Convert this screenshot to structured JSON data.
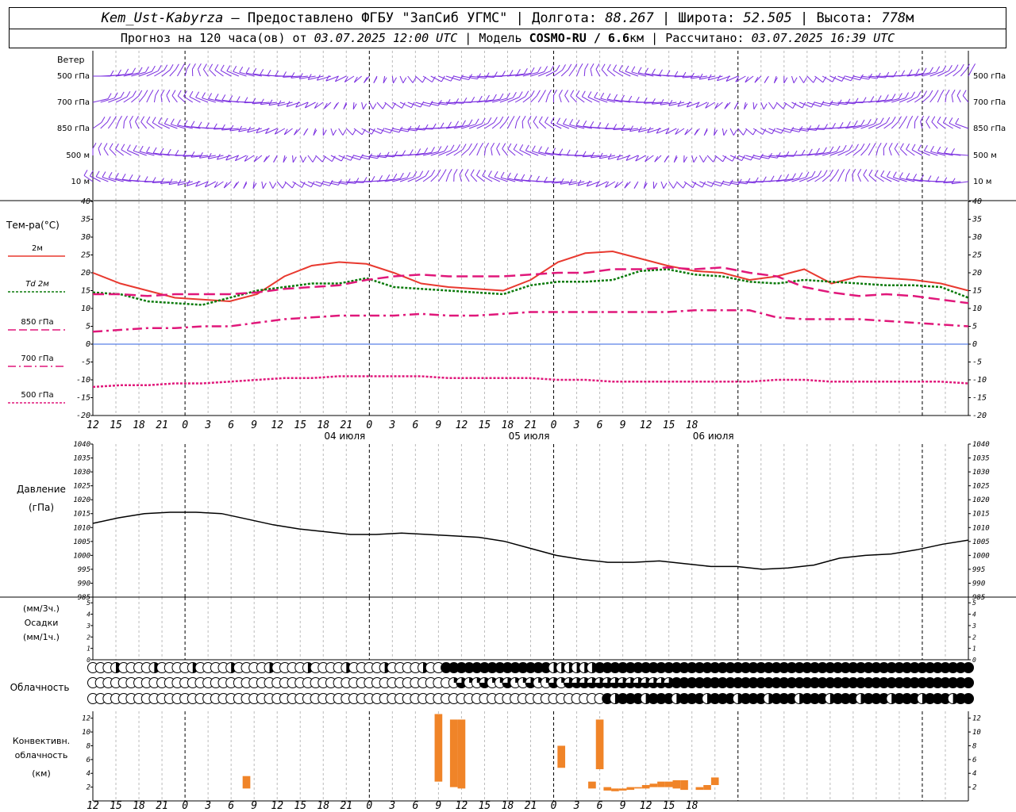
{
  "header": {
    "station": "Kem_Ust-Kabyrza",
    "sep": " — ",
    "provider": "Предоставлено ФГБУ \"ЗапСиб УГМС\"",
    "lon_label": "Долгота:",
    "lon": "88.267",
    "lat_label": "Широта:",
    "lat": "52.505",
    "alt_label": "Высота:",
    "alt": "778",
    "alt_unit": "м",
    "forecast_label": "Прогноз на 120 часа(ов) от",
    "forecast_time": "03.07.2025 12:00 UTC",
    "model_label": "Модель",
    "model": "COSMO-RU / 6.6",
    "model_unit": "км",
    "calc_label": "Рассчитано:",
    "calc_time": "03.07.2025 16:39 UTC"
  },
  "wind_panel": {
    "title": "Ветер",
    "levels": [
      "500 гПа",
      "700 гПа",
      "850 гПа",
      "500 м",
      "10  м"
    ]
  },
  "temp_panel": {
    "title": "Тем-ра(°C)",
    "legend": [
      "2м",
      "Td  2м",
      "850 гПа",
      "700 гПа",
      "500 гПа"
    ],
    "ylim": [
      -20,
      40
    ],
    "yticks": [
      "40",
      "35",
      "30",
      "25",
      "20",
      "15",
      "10",
      "5",
      "0",
      "-5",
      "-10",
      "-15",
      "-20"
    ]
  },
  "pressure_panel": {
    "title": "Давление",
    "unit": "(гПа)",
    "ylim": [
      985,
      1040
    ],
    "yticks": [
      "1040",
      "1035",
      "1030",
      "1025",
      "1020",
      "1015",
      "1010",
      "1005",
      "1000",
      "995",
      "990",
      "985"
    ]
  },
  "precip_panel": {
    "unit3": "(мм/3ч.)",
    "title": "Осадки",
    "unit1": "(мм/1ч.)",
    "yticks": [
      "5",
      "4",
      "3",
      "2",
      "1",
      "0"
    ]
  },
  "cloud_panel": {
    "title": "Облачность"
  },
  "conv_panel": {
    "title1": "Конвективн.",
    "title2": "облачность",
    "unit": "(км)",
    "yticks": [
      "12",
      "10",
      "8",
      "6",
      "4",
      "2"
    ]
  },
  "time_axis": {
    "hour_labels": [
      "12",
      "15",
      "18",
      "21",
      "0",
      "3",
      "6",
      "9",
      "12",
      "15",
      "18",
      "21",
      "0",
      "3",
      "6",
      "9",
      "12",
      "15",
      "18",
      "21",
      "0",
      "3",
      "6",
      "9",
      "12",
      "15",
      "18"
    ],
    "date_labels": [
      "04 июля",
      "05 июля",
      "06 июля"
    ]
  },
  "colors": {
    "wind": "#7a2ee0",
    "t2m": "#e8392f",
    "td2m": "#0a7a0a",
    "t850": "#e0177a",
    "t700": "#e0177a",
    "t500": "#e0177a",
    "pressure": "#000000",
    "conv": "#f08428",
    "zero_line": "#3060e0"
  },
  "chart_data": [
    {
      "type": "line",
      "title": "Тем-ра(°C)",
      "x_hours_from_start": [
        0,
        3,
        6,
        9,
        12,
        15,
        18,
        21,
        24,
        27,
        30,
        33,
        36,
        39,
        42,
        45,
        48,
        51,
        54,
        57,
        60,
        63,
        66,
        69,
        72,
        75,
        78,
        81,
        84,
        87,
        90,
        93,
        96,
        99,
        102,
        105,
        108,
        111,
        114
      ],
      "ylim": [
        -20,
        40
      ],
      "series": [
        {
          "name": "2м",
          "values": [
            20,
            17,
            15,
            13,
            12.5,
            12,
            14,
            19,
            22,
            23,
            22.5,
            20,
            17,
            16,
            15.5,
            15,
            18,
            23,
            25.5,
            26,
            24,
            22,
            20.5,
            20,
            18,
            19,
            21,
            17,
            19,
            18.5,
            18,
            17,
            15
          ]
        },
        {
          "name": "Td  2м",
          "values": [
            14.5,
            14,
            12,
            11.5,
            11,
            13,
            15,
            16,
            17,
            17,
            18.5,
            16,
            15.5,
            15,
            14.5,
            14,
            16.5,
            17.5,
            17.5,
            18,
            20.5,
            21,
            19.5,
            19,
            17.5,
            17,
            18,
            17.5,
            17,
            16.5,
            16.5,
            16,
            13
          ]
        },
        {
          "name": "850 гПа",
          "values": [
            14,
            14,
            13.5,
            14,
            14,
            14,
            14.5,
            15.5,
            16,
            16.5,
            18,
            19,
            19.5,
            19,
            19,
            19,
            19.5,
            20,
            20,
            21,
            21,
            21.5,
            21,
            21.5,
            20,
            19,
            16,
            14.5,
            13.5,
            14,
            13.5,
            12.5,
            11.5
          ]
        },
        {
          "name": "700 гПа",
          "values": [
            3.5,
            4,
            4.5,
            4.5,
            5,
            5,
            6,
            7,
            7.5,
            8,
            8,
            8,
            8.5,
            8,
            8,
            8.5,
            9,
            9,
            9,
            9,
            9,
            9,
            9.5,
            9.5,
            9.5,
            7.5,
            7,
            7,
            7,
            6.5,
            6,
            5.5,
            5
          ]
        },
        {
          "name": "500 гПа",
          "values": [
            -12,
            -11.5,
            -11.5,
            -11,
            -11,
            -10.5,
            -10,
            -9.5,
            -9.5,
            -9,
            -9,
            -9,
            -9,
            -9.5,
            -9.5,
            -9.5,
            -9.5,
            -10,
            -10,
            -10.5,
            -10.5,
            -10.5,
            -10.5,
            -10.5,
            -10.5,
            -10,
            -10,
            -10.5,
            -10.5,
            -10.5,
            -10.5,
            -10.5,
            -11
          ]
        }
      ]
    },
    {
      "type": "line",
      "title": "Давление",
      "ylim": [
        985,
        1040
      ],
      "x_hours_from_start": [
        0,
        3,
        6,
        9,
        12,
        15,
        18,
        21,
        24,
        27,
        30,
        33,
        36,
        39,
        42,
        45,
        48,
        51,
        54,
        57,
        60,
        63,
        66,
        69,
        72,
        75,
        78,
        81,
        84,
        87,
        90,
        93,
        96,
        99,
        102,
        105,
        108,
        111,
        114
      ],
      "series": [
        {
          "name": "",
          "values": [
            1011.5,
            1013.5,
            1015,
            1015.5,
            1015.5,
            1015,
            1013,
            1011,
            1009.5,
            1008.5,
            1007.5,
            1007.5,
            1008,
            1007.5,
            1007,
            1006.5,
            1005,
            1002.5,
            1000,
            998.5,
            997.5,
            997.5,
            998,
            997,
            996,
            996,
            995,
            995.5,
            996.5,
            999,
            1000,
            1000.5,
            1002,
            1004,
            1005.5
          ]
        }
      ]
    },
    {
      "type": "bar",
      "title": "Конвективн. облачность",
      "unit": "км",
      "bars": [
        {
          "hour": 20,
          "base": 1.8,
          "top": 3.6
        },
        {
          "hour": 45,
          "base": 2.8,
          "top": 12.6
        },
        {
          "hour": 47,
          "base": 2,
          "top": 11.8
        },
        {
          "hour": 48,
          "base": 1.8,
          "top": 11.8
        },
        {
          "hour": 61,
          "base": 4.8,
          "top": 8
        },
        {
          "hour": 65,
          "base": 1.8,
          "top": 2.8
        },
        {
          "hour": 66,
          "base": 4.6,
          "top": 11.8
        },
        {
          "hour": 67,
          "base": 1.5,
          "top": 2
        },
        {
          "hour": 68,
          "base": 1.4,
          "top": 1.8
        },
        {
          "hour": 69,
          "base": 1.5,
          "top": 1.8
        },
        {
          "hour": 70,
          "base": 1.6,
          "top": 2
        },
        {
          "hour": 71,
          "base": 1.8,
          "top": 2
        },
        {
          "hour": 72,
          "base": 1.8,
          "top": 2.3
        },
        {
          "hour": 73,
          "base": 2,
          "top": 2.5
        },
        {
          "hour": 74,
          "base": 2,
          "top": 2.8
        },
        {
          "hour": 75,
          "base": 2,
          "top": 2.8
        },
        {
          "hour": 76,
          "base": 1.8,
          "top": 3
        },
        {
          "hour": 77,
          "base": 1.6,
          "top": 3
        },
        {
          "hour": 79,
          "base": 1.6,
          "top": 2
        },
        {
          "hour": 80,
          "base": 1.6,
          "top": 2.3
        },
        {
          "hour": 81,
          "base": 2.3,
          "top": 3.4
        }
      ]
    }
  ]
}
